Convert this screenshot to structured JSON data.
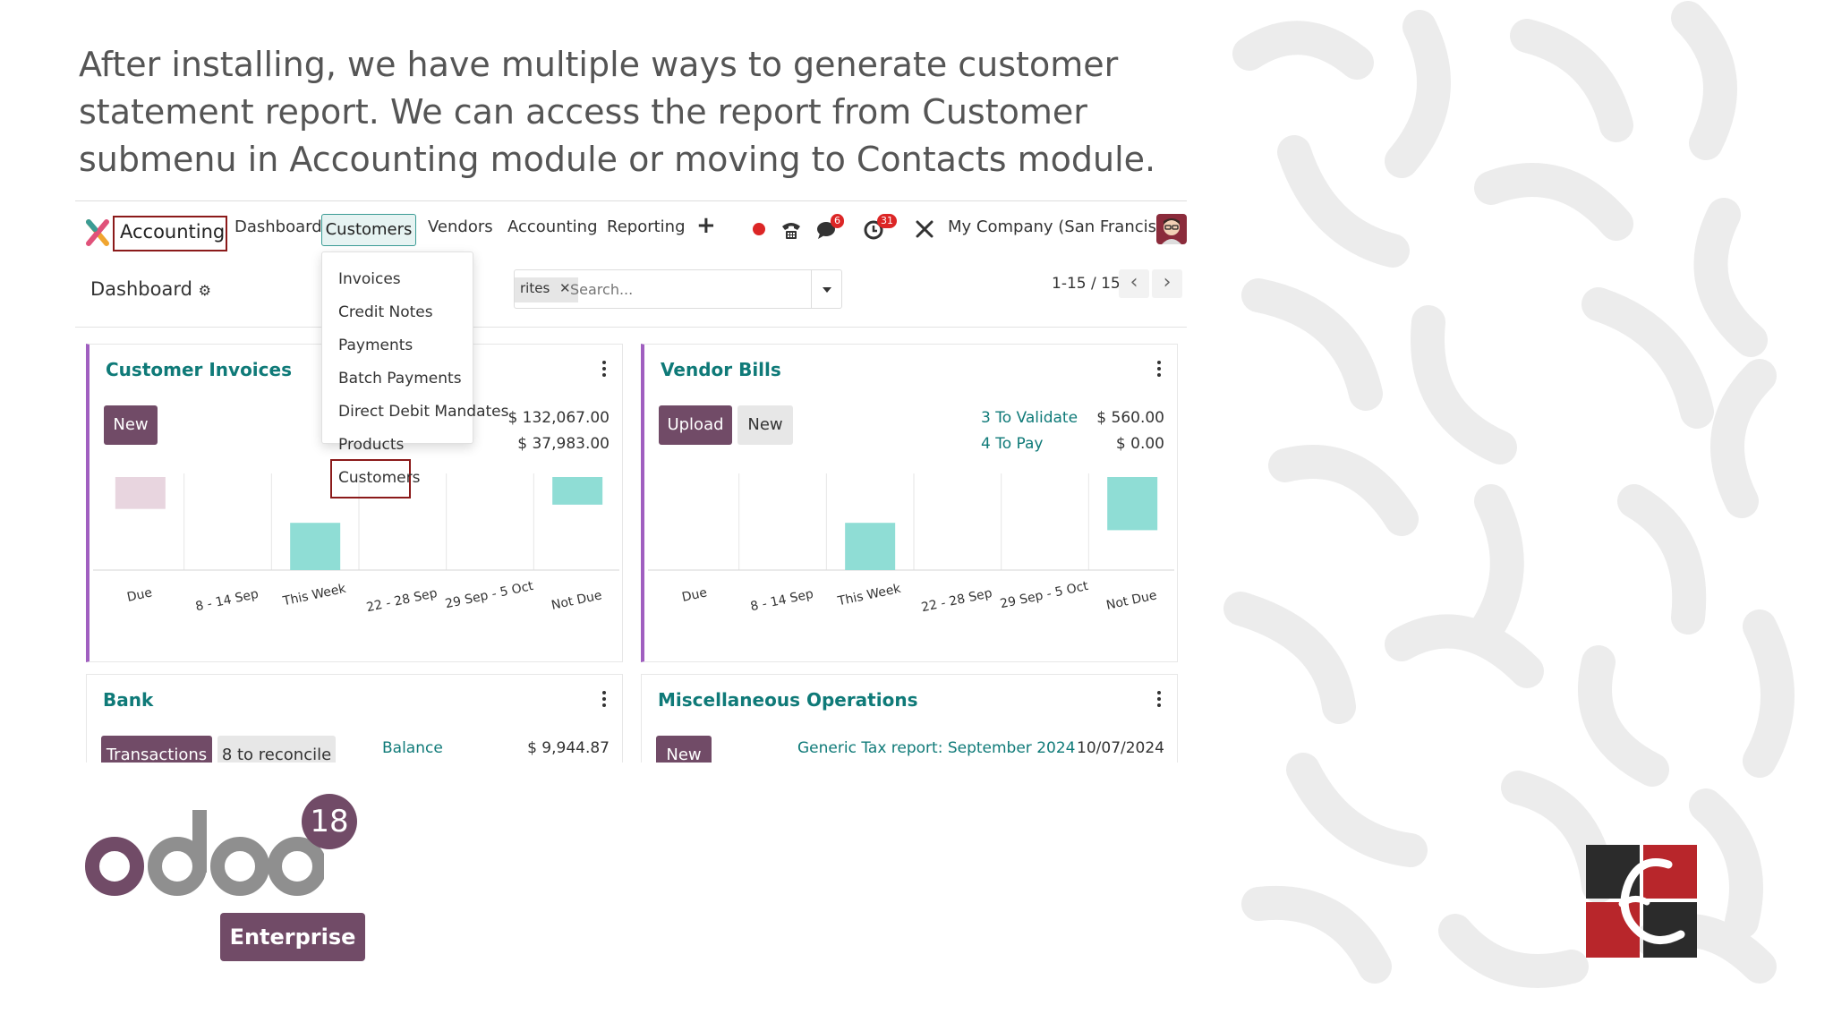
{
  "headline": "After installing, we have multiple ways to generate customer statement report. We can access the report from Customer submenu in Accounting module or moving to Contacts module.",
  "navbar": {
    "app_name": "Accounting",
    "menu": [
      "Dashboard",
      "Customers",
      "Vendors",
      "Accounting",
      "Reporting"
    ],
    "plus": "+",
    "chat_badge": "6",
    "activity_badge": "31",
    "company": "My Company (San Francisco)"
  },
  "control_panel": {
    "title": "Dashboard",
    "facet": "rites",
    "search_placeholder": "Search...",
    "pager": "1-15 / 15"
  },
  "dropdown": {
    "items": [
      "Invoices",
      "Credit Notes",
      "Payments",
      "Batch Payments",
      "Direct Debit Mandates",
      "Products",
      "Customers"
    ]
  },
  "cards": {
    "customer_invoices": {
      "title": "Customer Invoices",
      "new_label": "New",
      "amount1": "$ 132,067.00",
      "amount2": "$ 37,983.00"
    },
    "vendor_bills": {
      "title": "Vendor Bills",
      "upload_label": "Upload",
      "new_label": "New",
      "stat1_label": "3 To Validate",
      "stat1_value": "$ 560.00",
      "stat2_label": "4 To Pay",
      "stat2_value": "$ 0.00"
    },
    "bank": {
      "title": "Bank",
      "transactions_label": "Transactions",
      "reconcile_label": "8 to reconcile",
      "balance_label": "Balance",
      "balance_value": "$ 9,944.87"
    },
    "misc": {
      "title": "Miscellaneous Operations",
      "new_label": "New",
      "report_label": "Generic Tax report: September 2024",
      "report_date": "10/07/2024"
    }
  },
  "chart_data": [
    {
      "type": "bar",
      "title": "",
      "categories": [
        "Due",
        "8 - 14 Sep",
        "This Week",
        "22 - 28 Sep",
        "29 Sep - 5 Oct",
        "Not Due"
      ],
      "series": [
        {
          "values": [
            0.3,
            0,
            -0.5,
            0,
            0,
            0.26
          ]
        }
      ],
      "colors": [
        "#e8d5df",
        "#ffffff",
        "#8fddd5",
        "#ffffff",
        "#ffffff",
        "#8fddd5"
      ]
    },
    {
      "type": "bar",
      "title": "",
      "categories": [
        "Due",
        "8 - 14 Sep",
        "This Week",
        "22 - 28 Sep",
        "29 Sep - 5 Oct",
        "Not Due"
      ],
      "series": [
        {
          "values": [
            0,
            0,
            -0.5,
            0,
            0,
            0.5
          ]
        }
      ],
      "colors": [
        "#8fddd5",
        "#8fddd5",
        "#8fddd5",
        "#8fddd5",
        "#8fddd5",
        "#8fddd5"
      ]
    }
  ],
  "logos": {
    "odoo_version": "18",
    "odoo_edition": "Enterprise"
  },
  "colors": {
    "primary": "#714b67",
    "teal": "#0f7a78",
    "highlight_border": "#8b1a1a",
    "bar": "#8fddd5",
    "invoice_accent": "#a05fc0"
  }
}
